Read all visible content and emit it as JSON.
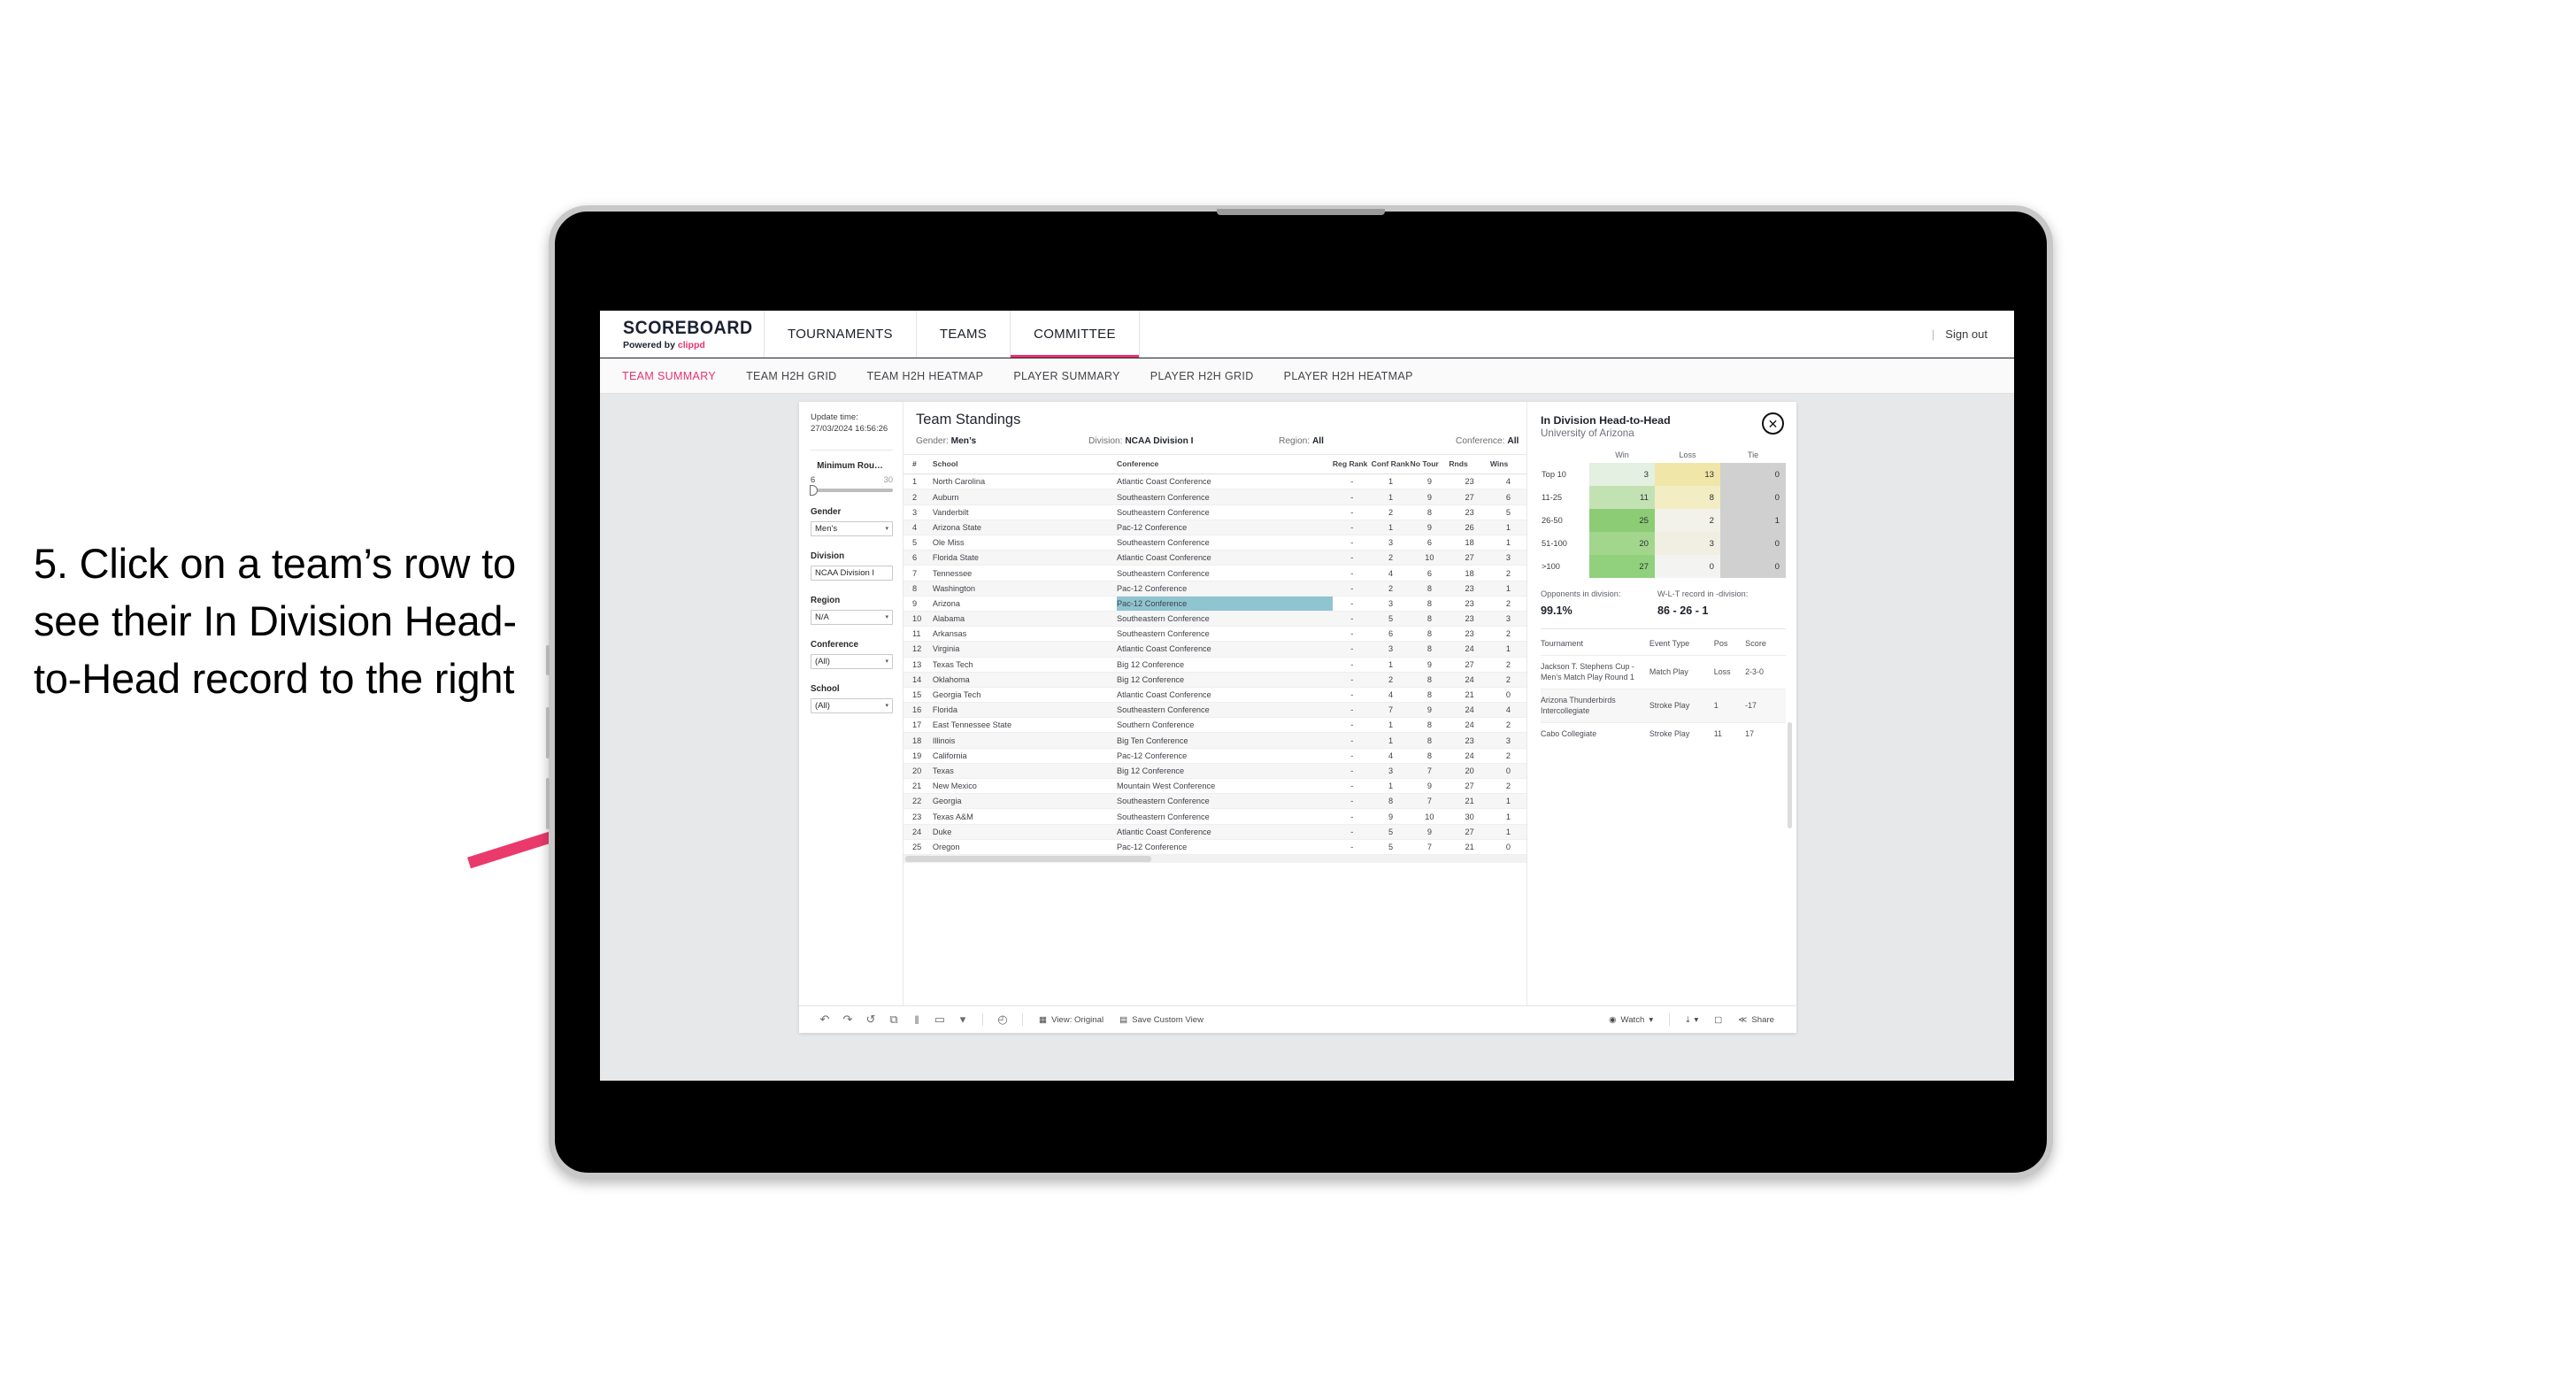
{
  "annotation": {
    "text": "5. Click on a team’s row to see their In Division Head-to-Head record to the right"
  },
  "colors": {
    "accent_pink": "#e8336d",
    "row_highlight": "#8fc4d1",
    "tie_grey": "#d0d0d0"
  },
  "header": {
    "brand_main": "SCOREBOARD",
    "brand_sub_prefix": "Powered by ",
    "brand_sub_name": "clippd",
    "nav": [
      {
        "label": "TOURNAMENTS",
        "active": false
      },
      {
        "label": "TEAMS",
        "active": false
      },
      {
        "label": "COMMITTEE",
        "active": true
      }
    ],
    "signout": "Sign out",
    "separator": "|"
  },
  "subnav": [
    {
      "label": "TEAM SUMMARY",
      "active": true
    },
    {
      "label": "TEAM H2H GRID",
      "active": false
    },
    {
      "label": "TEAM H2H HEATMAP",
      "active": false
    },
    {
      "label": "PLAYER SUMMARY",
      "active": false
    },
    {
      "label": "PLAYER H2H GRID",
      "active": false
    },
    {
      "label": "PLAYER H2H HEATMAP",
      "active": false
    }
  ],
  "filters": {
    "update_label": "Update time:",
    "update_value": "27/03/2024 16:56:26",
    "slider": {
      "title": "Minimum Rou…",
      "min": "6",
      "max": "30"
    },
    "gender": {
      "title": "Gender",
      "value": "Men’s"
    },
    "division": {
      "title": "Division",
      "value": "NCAA Division I"
    },
    "region": {
      "title": "Region",
      "value": "N/A"
    },
    "conference": {
      "title": "Conference",
      "value": "(All)"
    },
    "school": {
      "title": "School",
      "value": "(All)"
    },
    "caret": "▾"
  },
  "standings": {
    "title": "Team Standings",
    "meta": {
      "gender_label": "Gender: ",
      "gender_value": "Men’s",
      "division_label": "Division: ",
      "division_value": "NCAA Division I",
      "region_label": "Region: ",
      "region_value": "All",
      "conference_label": "Conference: ",
      "conference_value": "All"
    },
    "columns": [
      "#",
      "School",
      "Conference",
      "Reg Rank",
      "Conf Rank",
      "No Tour",
      "Rnds",
      "Wins"
    ],
    "rows": [
      {
        "rank": "1",
        "school": "North Carolina",
        "conf": "Atlantic Coast Conference",
        "reg": "-",
        "confrank": "1",
        "notour": "9",
        "rnds": "23",
        "wins": "4"
      },
      {
        "rank": "2",
        "school": "Auburn",
        "conf": "Southeastern Conference",
        "reg": "-",
        "confrank": "1",
        "notour": "9",
        "rnds": "27",
        "wins": "6"
      },
      {
        "rank": "3",
        "school": "Vanderbilt",
        "conf": "Southeastern Conference",
        "reg": "-",
        "confrank": "2",
        "notour": "8",
        "rnds": "23",
        "wins": "5"
      },
      {
        "rank": "4",
        "school": "Arizona State",
        "conf": "Pac-12 Conference",
        "reg": "-",
        "confrank": "1",
        "notour": "9",
        "rnds": "26",
        "wins": "1"
      },
      {
        "rank": "5",
        "school": "Ole Miss",
        "conf": "Southeastern Conference",
        "reg": "-",
        "confrank": "3",
        "notour": "6",
        "rnds": "18",
        "wins": "1"
      },
      {
        "rank": "6",
        "school": "Florida State",
        "conf": "Atlantic Coast Conference",
        "reg": "-",
        "confrank": "2",
        "notour": "10",
        "rnds": "27",
        "wins": "3"
      },
      {
        "rank": "7",
        "school": "Tennessee",
        "conf": "Southeastern Conference",
        "reg": "-",
        "confrank": "4",
        "notour": "6",
        "rnds": "18",
        "wins": "2"
      },
      {
        "rank": "8",
        "school": "Washington",
        "conf": "Pac-12 Conference",
        "reg": "-",
        "confrank": "2",
        "notour": "8",
        "rnds": "23",
        "wins": "1"
      },
      {
        "rank": "9",
        "school": "Arizona",
        "conf": "Pac-12 Conference",
        "reg": "-",
        "confrank": "3",
        "notour": "8",
        "rnds": "23",
        "wins": "2",
        "selected": true
      },
      {
        "rank": "10",
        "school": "Alabama",
        "conf": "Southeastern Conference",
        "reg": "-",
        "confrank": "5",
        "notour": "8",
        "rnds": "23",
        "wins": "3"
      },
      {
        "rank": "11",
        "school": "Arkansas",
        "conf": "Southeastern Conference",
        "reg": "-",
        "confrank": "6",
        "notour": "8",
        "rnds": "23",
        "wins": "2"
      },
      {
        "rank": "12",
        "school": "Virginia",
        "conf": "Atlantic Coast Conference",
        "reg": "-",
        "confrank": "3",
        "notour": "8",
        "rnds": "24",
        "wins": "1"
      },
      {
        "rank": "13",
        "school": "Texas Tech",
        "conf": "Big 12 Conference",
        "reg": "-",
        "confrank": "1",
        "notour": "9",
        "rnds": "27",
        "wins": "2"
      },
      {
        "rank": "14",
        "school": "Oklahoma",
        "conf": "Big 12 Conference",
        "reg": "-",
        "confrank": "2",
        "notour": "8",
        "rnds": "24",
        "wins": "2"
      },
      {
        "rank": "15",
        "school": "Georgia Tech",
        "conf": "Atlantic Coast Conference",
        "reg": "-",
        "confrank": "4",
        "notour": "8",
        "rnds": "21",
        "wins": "0"
      },
      {
        "rank": "16",
        "school": "Florida",
        "conf": "Southeastern Conference",
        "reg": "-",
        "confrank": "7",
        "notour": "9",
        "rnds": "24",
        "wins": "4"
      },
      {
        "rank": "17",
        "school": "East Tennessee State",
        "conf": "Southern Conference",
        "reg": "-",
        "confrank": "1",
        "notour": "8",
        "rnds": "24",
        "wins": "2"
      },
      {
        "rank": "18",
        "school": "Illinois",
        "conf": "Big Ten Conference",
        "reg": "-",
        "confrank": "1",
        "notour": "8",
        "rnds": "23",
        "wins": "3"
      },
      {
        "rank": "19",
        "school": "California",
        "conf": "Pac-12 Conference",
        "reg": "-",
        "confrank": "4",
        "notour": "8",
        "rnds": "24",
        "wins": "2"
      },
      {
        "rank": "20",
        "school": "Texas",
        "conf": "Big 12 Conference",
        "reg": "-",
        "confrank": "3",
        "notour": "7",
        "rnds": "20",
        "wins": "0"
      },
      {
        "rank": "21",
        "school": "New Mexico",
        "conf": "Mountain West Conference",
        "reg": "-",
        "confrank": "1",
        "notour": "9",
        "rnds": "27",
        "wins": "2"
      },
      {
        "rank": "22",
        "school": "Georgia",
        "conf": "Southeastern Conference",
        "reg": "-",
        "confrank": "8",
        "notour": "7",
        "rnds": "21",
        "wins": "1"
      },
      {
        "rank": "23",
        "school": "Texas A&M",
        "conf": "Southeastern Conference",
        "reg": "-",
        "confrank": "9",
        "notour": "10",
        "rnds": "30",
        "wins": "1"
      },
      {
        "rank": "24",
        "school": "Duke",
        "conf": "Atlantic Coast Conference",
        "reg": "-",
        "confrank": "5",
        "notour": "9",
        "rnds": "27",
        "wins": "1"
      },
      {
        "rank": "25",
        "school": "Oregon",
        "conf": "Pac-12 Conference",
        "reg": "-",
        "confrank": "5",
        "notour": "7",
        "rnds": "21",
        "wins": "0"
      }
    ]
  },
  "h2h": {
    "title": "In Division Head-to-Head",
    "subtitle": "University of Arizona",
    "close_icon": "✕",
    "columns": [
      "",
      "Win",
      "Loss",
      "Tie"
    ],
    "rows": [
      {
        "band": "Top 10",
        "win": "3",
        "loss": "13",
        "tie": "0",
        "win_color": "#e4f0e1",
        "loss_color": "#f0e6a8"
      },
      {
        "band": "11-25",
        "win": "11",
        "loss": "8",
        "tie": "0",
        "win_color": "#c3e2b4",
        "loss_color": "#f3edc4"
      },
      {
        "band": "26-50",
        "win": "25",
        "loss": "2",
        "tie": "1",
        "win_color": "#8bcc74",
        "loss_color": "#f2f1ea"
      },
      {
        "band": "51-100",
        "win": "20",
        "loss": "3",
        "tie": "0",
        "win_color": "#a2d68c",
        "loss_color": "#f1eee2"
      },
      {
        "band": ">100",
        "win": "27",
        "loss": "0",
        "tie": "0",
        "win_color": "#91d07c",
        "loss_color": "#f3f3f1"
      }
    ],
    "stats": {
      "opponents_label": "Opponents in division:",
      "opponents_value": "99.1%",
      "record_label": "W-L-T record in -division:",
      "record_value": "86 - 26 - 1"
    },
    "tournament_columns": [
      "Tournament",
      "Event Type",
      "Pos",
      "Score"
    ],
    "tournaments": [
      {
        "name": "Jackson T. Stephens Cup - Men’s Match Play Round 1",
        "type": "Match Play",
        "pos": "Loss",
        "score": "2-3-0"
      },
      {
        "name": "Arizona Thunderbirds Intercollegiate",
        "type": "Stroke Play",
        "pos": "1",
        "score": "-17"
      },
      {
        "name": "Cabo Collegiate",
        "type": "Stroke Play",
        "pos": "11",
        "score": "17"
      }
    ]
  },
  "toolbar": {
    "undo_icon": "↶",
    "redo_icon": "↷",
    "revert_icon": "↺",
    "refresh_icon": "⧉",
    "pause_icon": "‖",
    "rect_icon": "▭",
    "caret": "▾",
    "clock_icon": "◴",
    "view_label": "View: Original",
    "save_label": "Save Custom View",
    "watch_label": "Watch",
    "share_label": "Share",
    "download_icon": "⤓",
    "device_icon": "▢",
    "share_icon": "≪"
  }
}
